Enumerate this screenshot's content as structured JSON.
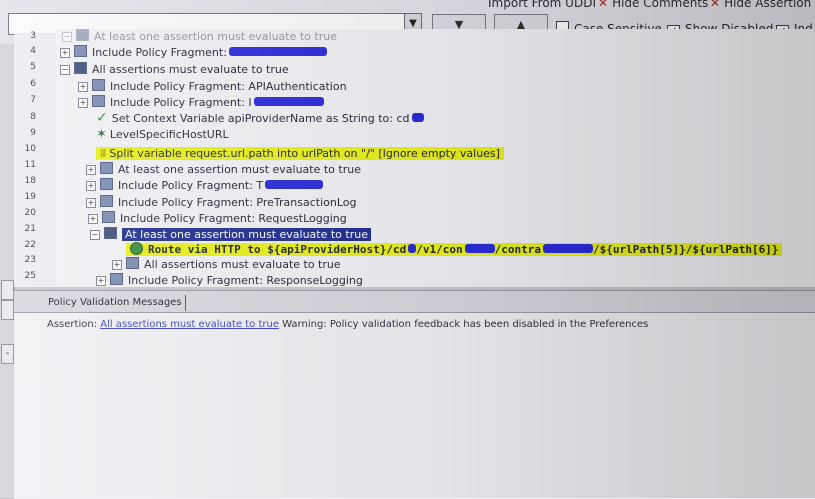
{
  "toolbar": {
    "top_links": [
      "Import From UDDI",
      "Hide Comments",
      "Hide Assertion N"
    ],
    "up_arrow": "▼",
    "down_arrow": "▲",
    "case_sensitive_label": "Case Sensitive",
    "case_sensitive_checked": false,
    "show_disabled_label": "Show Disabled",
    "show_disabled_checked": true,
    "ind_label": "Ind",
    "ind_checked": true
  },
  "tree": {
    "rows": [
      {
        "num": "3",
        "text": "At least one assertion must evaluate to true"
      },
      {
        "num": "4",
        "text": "Include Policy Fragment:"
      },
      {
        "num": "5",
        "text": "All assertions must evaluate to true"
      },
      {
        "num": "6",
        "text": "Include Policy Fragment: APIAuthentication"
      },
      {
        "num": "7",
        "text": "Include Policy Fragment: I"
      },
      {
        "num": "8",
        "text": "Set Context Variable apiProviderName as String to: cd"
      },
      {
        "num": "9",
        "text": "LevelSpecificHostURL"
      },
      {
        "num": "10",
        "text": "Split variable request.url.path into urlPath on \"/\"  [Ignore empty values]"
      },
      {
        "num": "11",
        "text": "At least one assertion must evaluate to true"
      },
      {
        "num": "18",
        "text": "Include Policy Fragment: T"
      },
      {
        "num": "19",
        "text": "Include Policy Fragment: PreTransactionLog"
      },
      {
        "num": "20",
        "text": "Include Policy Fragment: RequestLogging"
      },
      {
        "num": "21",
        "text": "At least one assertion must evaluate to true"
      },
      {
        "num": "22",
        "text_a": "Route via HTTP to ${apiProviderHost}/cd",
        "text_b": "/v1/con",
        "text_c": "/contra",
        "text_d": "/${urlPath[5]}/${urlPath[6]}"
      },
      {
        "num": "23",
        "text": "All assertions must evaluate to true"
      },
      {
        "num": "25",
        "text": "Include Policy Fragment: ResponseLogging"
      }
    ]
  },
  "messages": {
    "tab_label": "Policy Validation Messages",
    "line_prefix": "Assertion: ",
    "line_link": "All assertions must evaluate to true",
    "line_rest": " Warning: Policy validation feedback has been disabled in the Preferences"
  }
}
